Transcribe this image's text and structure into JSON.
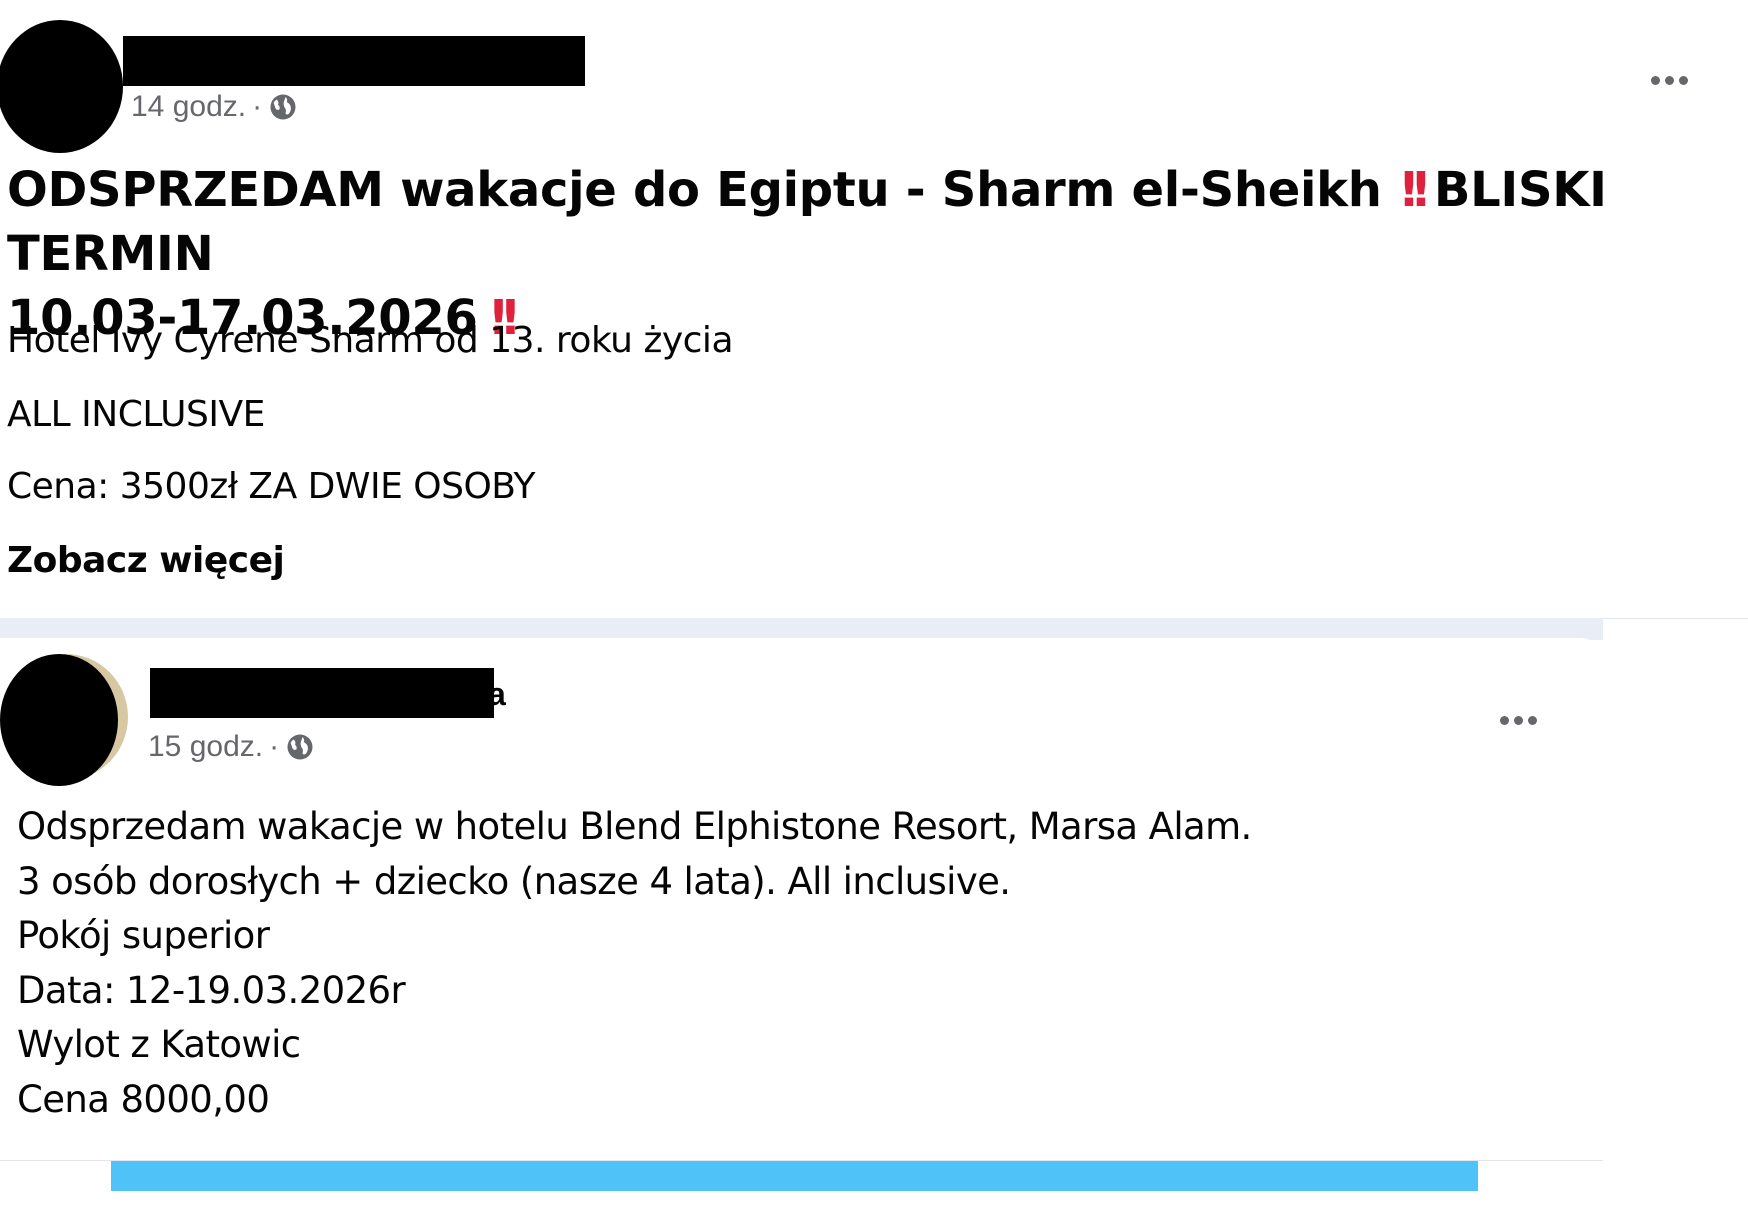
{
  "post1": {
    "time": "14 godz.",
    "separator": "·",
    "title_part1": "ODSPRZEDAM wakacje do Egiptu - Sharm el-Sheikh",
    "title_emoji1": "!!",
    "title_part2": "BLISKI TERMIN",
    "title_line2": "10.03-17.03.2026",
    "title_emoji2": "!!",
    "line1": "Hotel Ivy Cyrene Sharm od 13. roku życia",
    "line2": "ALL INCLUSIVE",
    "line3": "Cena: 3500zł ZA DWIE OSOBY",
    "see_more": "Zobacz więcej"
  },
  "post2": {
    "name_tail": "a",
    "time": "15 godz.",
    "separator": "·",
    "body": [
      "Odsprzedam wakacje w hotelu Blend Elphistone Resort, Marsa Alam.",
      "3 osób dorosłych + dziecko (nasze 4 lata). All inclusive.",
      "Pokój superior",
      "Data: 12-19.03.2026r",
      "Wylot z Katowic",
      "Cena 8000,00"
    ]
  },
  "icons": {
    "privacy": "globe-icon",
    "menu": "more-options-icon",
    "emphasis": "double-exclamation-emoji"
  },
  "colors": {
    "text": "#050505",
    "meta": "#65676b",
    "emoji_red": "#e0213d",
    "divider": "#e9eef6",
    "bottom_bar": "#4fc3f7"
  }
}
